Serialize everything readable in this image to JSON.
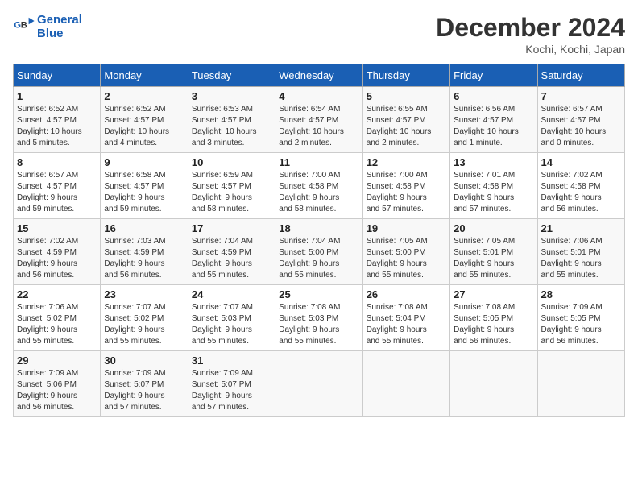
{
  "header": {
    "logo_line1": "General",
    "logo_line2": "Blue",
    "month_title": "December 2024",
    "subtitle": "Kochi, Kochi, Japan"
  },
  "days_of_week": [
    "Sunday",
    "Monday",
    "Tuesday",
    "Wednesday",
    "Thursday",
    "Friday",
    "Saturday"
  ],
  "weeks": [
    [
      {
        "day": "1",
        "info": "Sunrise: 6:52 AM\nSunset: 4:57 PM\nDaylight: 10 hours\nand 5 minutes."
      },
      {
        "day": "2",
        "info": "Sunrise: 6:52 AM\nSunset: 4:57 PM\nDaylight: 10 hours\nand 4 minutes."
      },
      {
        "day": "3",
        "info": "Sunrise: 6:53 AM\nSunset: 4:57 PM\nDaylight: 10 hours\nand 3 minutes."
      },
      {
        "day": "4",
        "info": "Sunrise: 6:54 AM\nSunset: 4:57 PM\nDaylight: 10 hours\nand 2 minutes."
      },
      {
        "day": "5",
        "info": "Sunrise: 6:55 AM\nSunset: 4:57 PM\nDaylight: 10 hours\nand 2 minutes."
      },
      {
        "day": "6",
        "info": "Sunrise: 6:56 AM\nSunset: 4:57 PM\nDaylight: 10 hours\nand 1 minute."
      },
      {
        "day": "7",
        "info": "Sunrise: 6:57 AM\nSunset: 4:57 PM\nDaylight: 10 hours\nand 0 minutes."
      }
    ],
    [
      {
        "day": "8",
        "info": "Sunrise: 6:57 AM\nSunset: 4:57 PM\nDaylight: 9 hours\nand 59 minutes."
      },
      {
        "day": "9",
        "info": "Sunrise: 6:58 AM\nSunset: 4:57 PM\nDaylight: 9 hours\nand 59 minutes."
      },
      {
        "day": "10",
        "info": "Sunrise: 6:59 AM\nSunset: 4:57 PM\nDaylight: 9 hours\nand 58 minutes."
      },
      {
        "day": "11",
        "info": "Sunrise: 7:00 AM\nSunset: 4:58 PM\nDaylight: 9 hours\nand 58 minutes."
      },
      {
        "day": "12",
        "info": "Sunrise: 7:00 AM\nSunset: 4:58 PM\nDaylight: 9 hours\nand 57 minutes."
      },
      {
        "day": "13",
        "info": "Sunrise: 7:01 AM\nSunset: 4:58 PM\nDaylight: 9 hours\nand 57 minutes."
      },
      {
        "day": "14",
        "info": "Sunrise: 7:02 AM\nSunset: 4:58 PM\nDaylight: 9 hours\nand 56 minutes."
      }
    ],
    [
      {
        "day": "15",
        "info": "Sunrise: 7:02 AM\nSunset: 4:59 PM\nDaylight: 9 hours\nand 56 minutes."
      },
      {
        "day": "16",
        "info": "Sunrise: 7:03 AM\nSunset: 4:59 PM\nDaylight: 9 hours\nand 56 minutes."
      },
      {
        "day": "17",
        "info": "Sunrise: 7:04 AM\nSunset: 4:59 PM\nDaylight: 9 hours\nand 55 minutes."
      },
      {
        "day": "18",
        "info": "Sunrise: 7:04 AM\nSunset: 5:00 PM\nDaylight: 9 hours\nand 55 minutes."
      },
      {
        "day": "19",
        "info": "Sunrise: 7:05 AM\nSunset: 5:00 PM\nDaylight: 9 hours\nand 55 minutes."
      },
      {
        "day": "20",
        "info": "Sunrise: 7:05 AM\nSunset: 5:01 PM\nDaylight: 9 hours\nand 55 minutes."
      },
      {
        "day": "21",
        "info": "Sunrise: 7:06 AM\nSunset: 5:01 PM\nDaylight: 9 hours\nand 55 minutes."
      }
    ],
    [
      {
        "day": "22",
        "info": "Sunrise: 7:06 AM\nSunset: 5:02 PM\nDaylight: 9 hours\nand 55 minutes."
      },
      {
        "day": "23",
        "info": "Sunrise: 7:07 AM\nSunset: 5:02 PM\nDaylight: 9 hours\nand 55 minutes."
      },
      {
        "day": "24",
        "info": "Sunrise: 7:07 AM\nSunset: 5:03 PM\nDaylight: 9 hours\nand 55 minutes."
      },
      {
        "day": "25",
        "info": "Sunrise: 7:08 AM\nSunset: 5:03 PM\nDaylight: 9 hours\nand 55 minutes."
      },
      {
        "day": "26",
        "info": "Sunrise: 7:08 AM\nSunset: 5:04 PM\nDaylight: 9 hours\nand 55 minutes."
      },
      {
        "day": "27",
        "info": "Sunrise: 7:08 AM\nSunset: 5:05 PM\nDaylight: 9 hours\nand 56 minutes."
      },
      {
        "day": "28",
        "info": "Sunrise: 7:09 AM\nSunset: 5:05 PM\nDaylight: 9 hours\nand 56 minutes."
      }
    ],
    [
      {
        "day": "29",
        "info": "Sunrise: 7:09 AM\nSunset: 5:06 PM\nDaylight: 9 hours\nand 56 minutes."
      },
      {
        "day": "30",
        "info": "Sunrise: 7:09 AM\nSunset: 5:07 PM\nDaylight: 9 hours\nand 57 minutes."
      },
      {
        "day": "31",
        "info": "Sunrise: 7:09 AM\nSunset: 5:07 PM\nDaylight: 9 hours\nand 57 minutes."
      },
      {
        "day": "",
        "info": ""
      },
      {
        "day": "",
        "info": ""
      },
      {
        "day": "",
        "info": ""
      },
      {
        "day": "",
        "info": ""
      }
    ]
  ]
}
